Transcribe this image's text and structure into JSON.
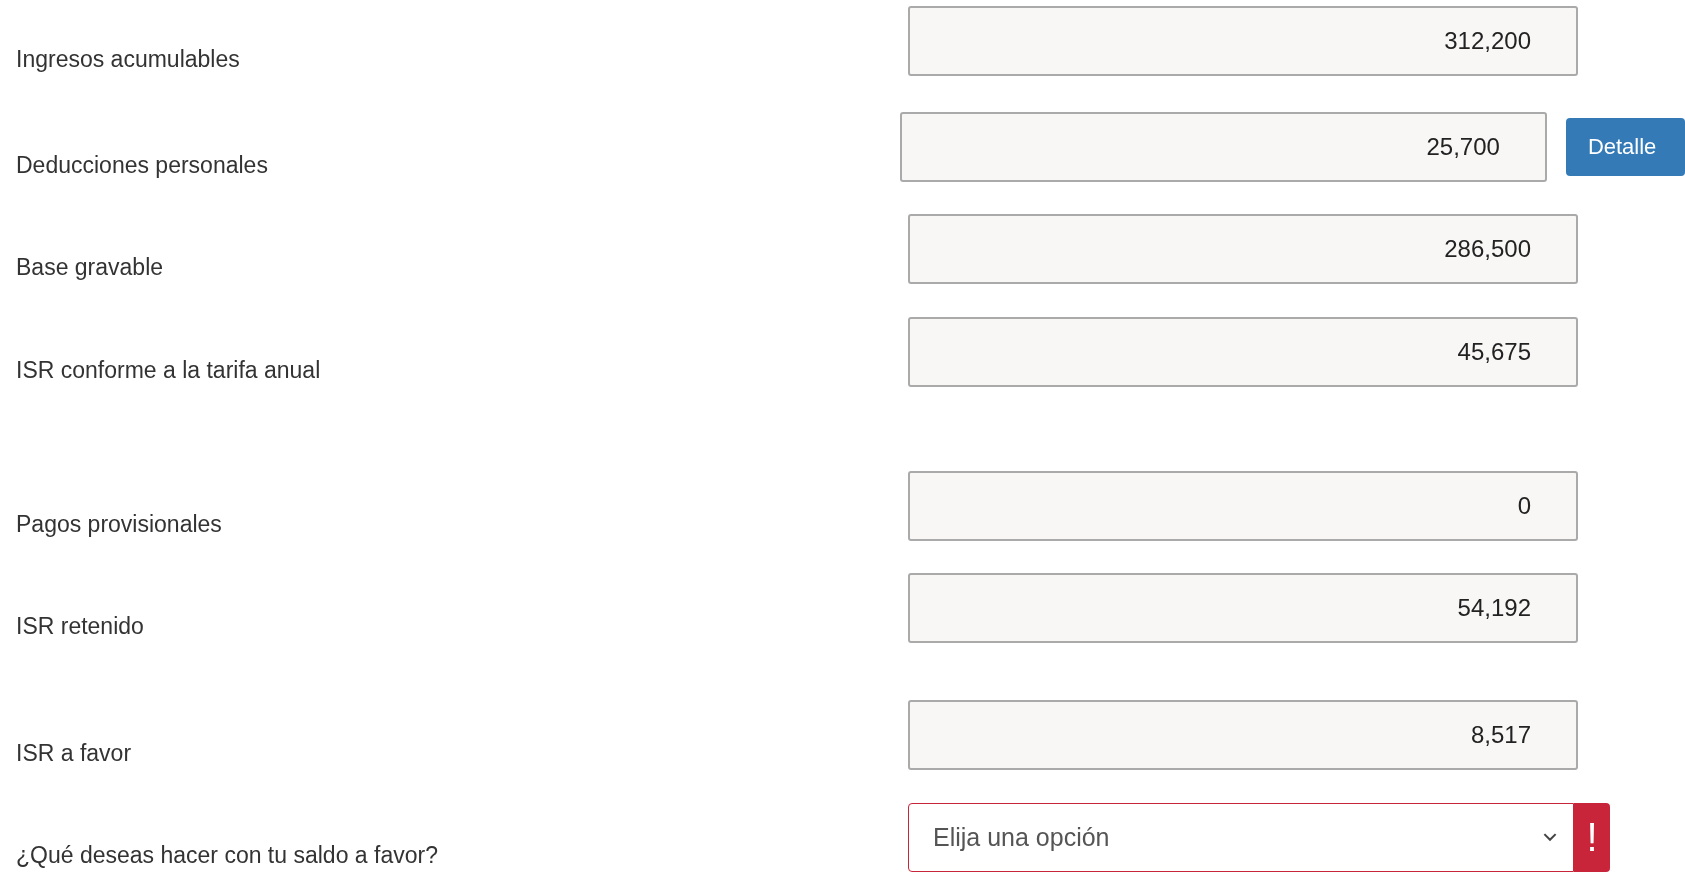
{
  "rows": [
    {
      "kind": "amount",
      "label": "Ingresos acumulables",
      "value": "312,200"
    },
    {
      "kind": "amount_detail",
      "label": "Deducciones personales",
      "value": "25,700",
      "button": "Detalle"
    },
    {
      "kind": "amount",
      "label": "Base gravable",
      "value": "286,500"
    },
    {
      "kind": "amount",
      "label": "ISR conforme a la tarifa anual",
      "value": "45,675"
    },
    {
      "kind": "amount",
      "label": "Pagos provisionales",
      "value": "0"
    },
    {
      "kind": "amount",
      "label": "ISR retenido",
      "value": "54,192"
    },
    {
      "kind": "amount",
      "label": "ISR a favor",
      "value": "8,517"
    },
    {
      "kind": "select",
      "label": "¿Qué deseas hacer con tu saldo a favor?",
      "placeholder": "Elija una opción",
      "invalid": true,
      "alert": "!"
    }
  ]
}
